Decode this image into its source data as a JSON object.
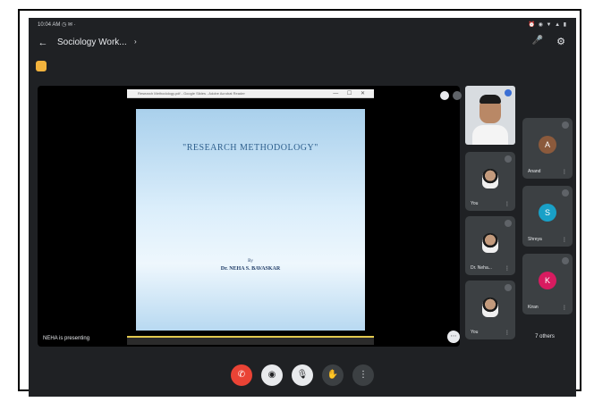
{
  "statusbar": {
    "left_text": "10:04 AM ◷ ✉ ·",
    "right_text": "⏰ ◉ ▼ ▲ ▮"
  },
  "appbar": {
    "back_glyph": "←",
    "meeting_title": "Sociology Work...",
    "chevron_glyph": "›",
    "mic_glyph": "🎤",
    "settings_glyph": "⚙"
  },
  "stage": {
    "slide": {
      "titlebar_text": "Research Methodology.pdf - Google Slides - Adobe Acrobat Reader",
      "titlebar_controls": "— ☐ ✕",
      "heading": "\"RESEARCH METHODOLOGY\"",
      "by_text": "By",
      "author": "Dr. NEHA S. BAVASKAR"
    },
    "presenting_label": "NEHA is presenting",
    "options_glyph": "⋯"
  },
  "participants": [
    {
      "name": "You",
      "mic_glyph": "⋮",
      "kind": "photo"
    },
    {
      "name": "Dr. Neha...",
      "mic_glyph": "⋮",
      "kind": "photo"
    },
    {
      "name": "You",
      "mic_glyph": "⋮",
      "kind": "photo"
    },
    {
      "name": "Anand",
      "mic_glyph": "⋮",
      "kind": "initial",
      "initial": "A",
      "color": "#8b5a3c"
    },
    {
      "name": "Shreya",
      "mic_glyph": "⋮",
      "kind": "initial",
      "initial": "S",
      "color": "#19a0c7"
    },
    {
      "name": "Kiran",
      "mic_glyph": "⋮",
      "kind": "initial",
      "initial": "K",
      "color": "#d81b60"
    }
  ],
  "others_label": "7 others",
  "controls": {
    "end_glyph": "✆",
    "camera_glyph": "◉",
    "mic_glyph": "🎙",
    "hand_glyph": "✋",
    "more_glyph": "⋮"
  }
}
